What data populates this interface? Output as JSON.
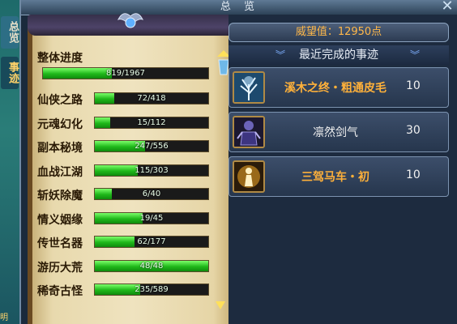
{
  "side_tabs": {
    "overview": "总览",
    "events": "事迹",
    "corner": "明"
  },
  "window": {
    "title": "总 览",
    "close": "✕"
  },
  "progress": {
    "overall": {
      "label": "整体进度",
      "current": 819,
      "total": 1967,
      "text": "819/1967"
    },
    "categories": [
      {
        "label": "仙侠之路",
        "current": 72,
        "total": 418,
        "text": "72/418"
      },
      {
        "label": "元魂幻化",
        "current": 15,
        "total": 112,
        "text": "15/112"
      },
      {
        "label": "副本秘境",
        "current": 247,
        "total": 556,
        "text": "247/556"
      },
      {
        "label": "血战江湖",
        "current": 115,
        "total": 303,
        "text": "115/303"
      },
      {
        "label": "斩妖除魔",
        "current": 6,
        "total": 40,
        "text": "6/40"
      },
      {
        "label": "情义姻缘",
        "current": 19,
        "total": 45,
        "text": "19/45"
      },
      {
        "label": "传世名器",
        "current": 62,
        "total": 177,
        "text": "62/177"
      },
      {
        "label": "游历大荒",
        "current": 48,
        "total": 48,
        "text": "48/48"
      },
      {
        "label": "稀奇古怪",
        "current": 235,
        "total": 589,
        "text": "235/589"
      }
    ]
  },
  "prestige": {
    "text": "威望值：12950点"
  },
  "recent": {
    "header": "最近完成的事迹",
    "items": [
      {
        "name": "溪木之终・粗通皮毛",
        "points": "10",
        "icon": "frost-tree-icon",
        "highlight": true
      },
      {
        "name": "凛然剑气",
        "points": "30",
        "icon": "armored-warrior-icon",
        "highlight": false
      },
      {
        "name": "三驾马车・初",
        "points": "10",
        "icon": "golden-figure-icon",
        "highlight": true
      }
    ]
  },
  "colors": {
    "bar_fill": "#1fb81a",
    "highlight_text": "#ffb13a",
    "parchment": "#efe3bf"
  }
}
